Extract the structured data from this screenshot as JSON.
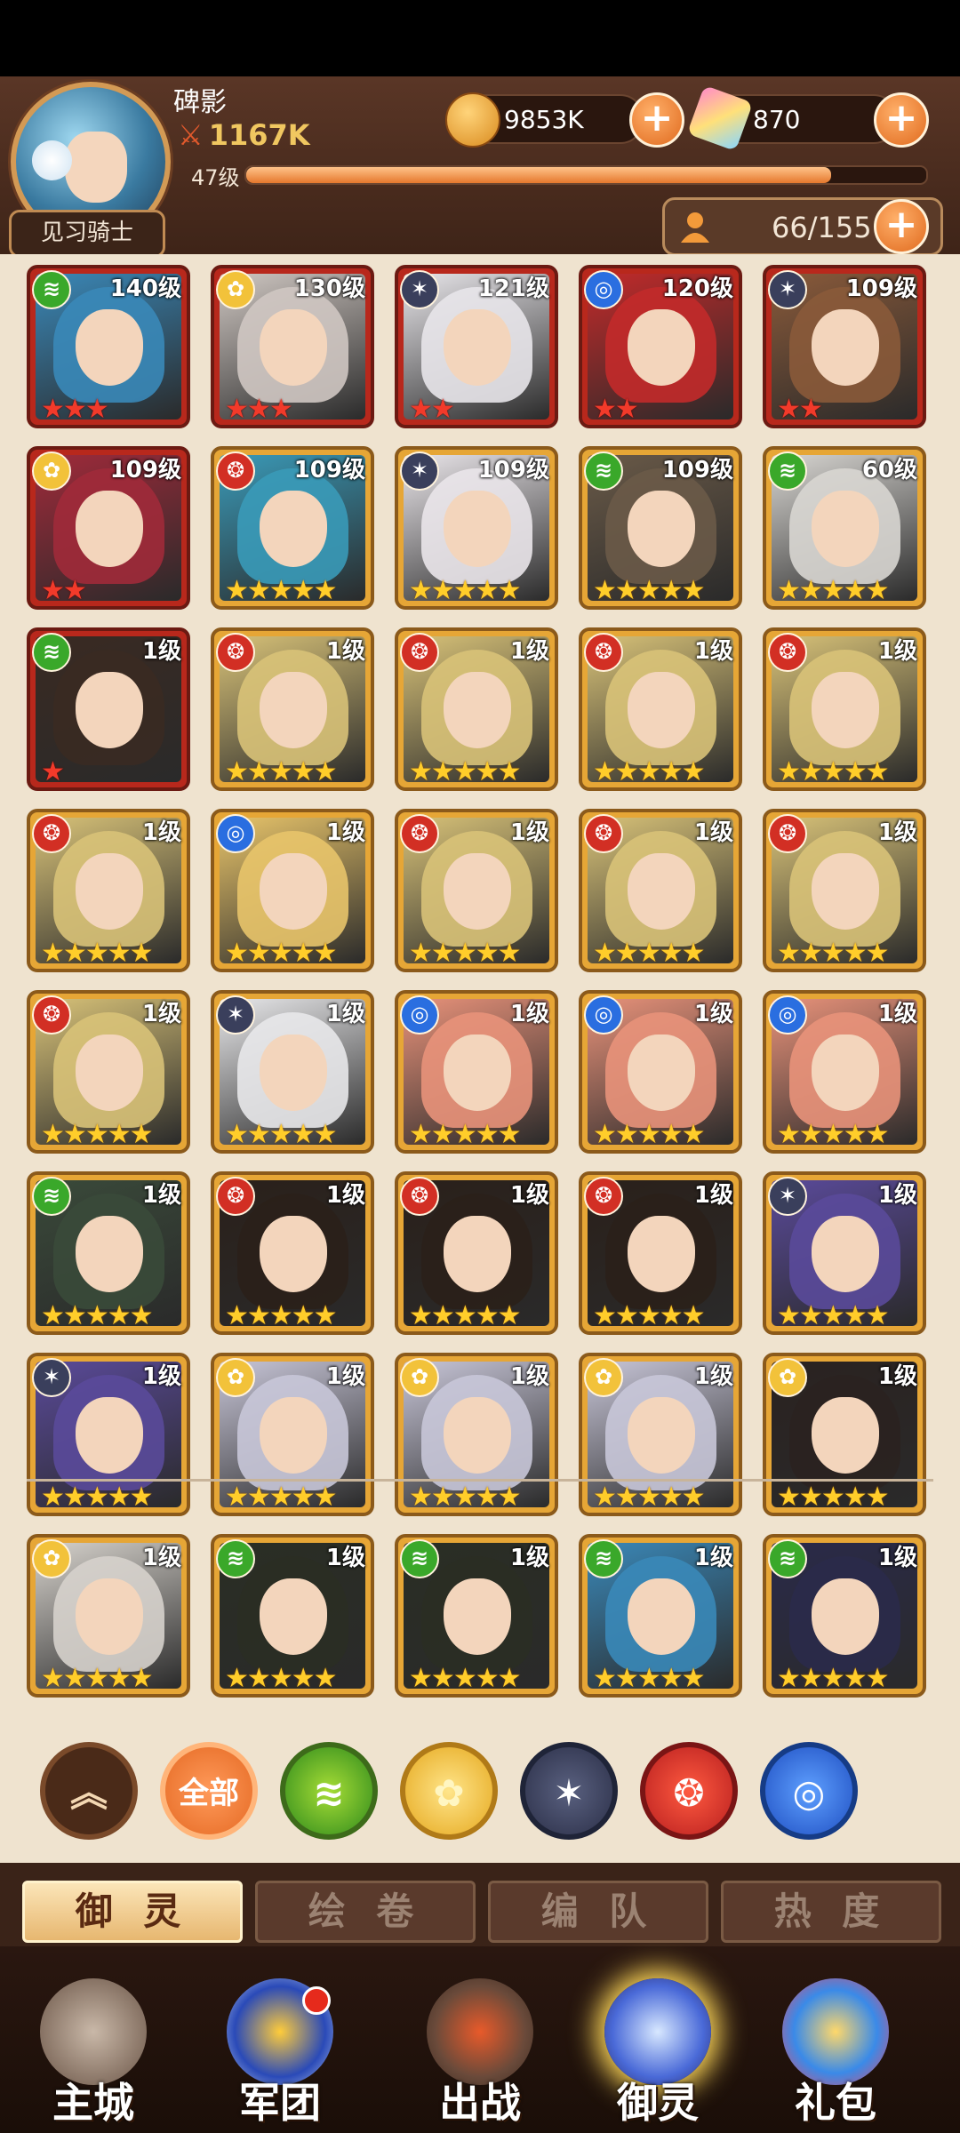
{
  "player": {
    "name": "碑影",
    "power": "1167K",
    "level": "47级",
    "xp_fraction": 0.86,
    "title": "见习骑士"
  },
  "currency": {
    "gold": "9853K",
    "gems": "870"
  },
  "capacity": "66/155",
  "colors": {
    "wind": "#3aa82a",
    "light": "#f2c23a",
    "dark": "#3a3f5c",
    "fire": "#d22f24",
    "water": "#2a6ee0"
  },
  "heroes": [
    {
      "element": "wind",
      "level": "140级",
      "stars": 3,
      "star_color": "red",
      "frame": "red",
      "tone": "#3a88b8"
    },
    {
      "element": "light",
      "level": "130级",
      "stars": 3,
      "star_color": "red",
      "frame": "red",
      "tone": "#cfc7c2"
    },
    {
      "element": "dark",
      "level": "121级",
      "stars": 2,
      "star_color": "red",
      "frame": "red",
      "tone": "#e8e6ea"
    },
    {
      "element": "water",
      "level": "120级",
      "stars": 2,
      "star_color": "red",
      "frame": "red",
      "tone": "#c22a2a"
    },
    {
      "element": "dark",
      "level": "109级",
      "stars": 2,
      "star_color": "red",
      "frame": "red",
      "tone": "#8a5a3a"
    },
    {
      "element": "light",
      "level": "109级",
      "stars": 2,
      "star_color": "red",
      "frame": "red",
      "tone": "#a02a3a"
    },
    {
      "element": "fire",
      "level": "109级",
      "stars": 5,
      "star_color": "gold",
      "frame": "gold",
      "tone": "#3a9ab8"
    },
    {
      "element": "dark",
      "level": "109级",
      "stars": 5,
      "star_color": "gold",
      "frame": "gold",
      "tone": "#eae6ea"
    },
    {
      "element": "wind",
      "level": "109级",
      "stars": 5,
      "star_color": "gold",
      "frame": "gold",
      "tone": "#6a5a48"
    },
    {
      "element": "wind",
      "level": "60级",
      "stars": 5,
      "star_color": "gold",
      "frame": "gold",
      "tone": "#d8d6d2"
    },
    {
      "element": "wind",
      "level": "1级",
      "stars": 1,
      "star_color": "red",
      "frame": "red",
      "tone": "#3a2a22"
    },
    {
      "element": "fire",
      "level": "1级",
      "stars": 5,
      "star_color": "gold",
      "frame": "gold",
      "tone": "#d8c278"
    },
    {
      "element": "fire",
      "level": "1级",
      "stars": 5,
      "star_color": "gold",
      "frame": "gold",
      "tone": "#d8c278"
    },
    {
      "element": "fire",
      "level": "1级",
      "stars": 5,
      "star_color": "gold",
      "frame": "gold",
      "tone": "#d8c278"
    },
    {
      "element": "fire",
      "level": "1级",
      "stars": 5,
      "star_color": "gold",
      "frame": "gold",
      "tone": "#d8c278"
    },
    {
      "element": "fire",
      "level": "1级",
      "stars": 5,
      "star_color": "gold",
      "frame": "gold",
      "tone": "#d8c278"
    },
    {
      "element": "water",
      "level": "1级",
      "stars": 5,
      "star_color": "gold",
      "frame": "gold",
      "tone": "#e8c46a"
    },
    {
      "element": "fire",
      "level": "1级",
      "stars": 5,
      "star_color": "gold",
      "frame": "gold",
      "tone": "#d8c278"
    },
    {
      "element": "fire",
      "level": "1级",
      "stars": 5,
      "star_color": "gold",
      "frame": "gold",
      "tone": "#d8c278"
    },
    {
      "element": "fire",
      "level": "1级",
      "stars": 5,
      "star_color": "gold",
      "frame": "gold",
      "tone": "#d8c278"
    },
    {
      "element": "fire",
      "level": "1级",
      "stars": 5,
      "star_color": "gold",
      "frame": "gold",
      "tone": "#d8c278"
    },
    {
      "element": "dark",
      "level": "1级",
      "stars": 5,
      "star_color": "gold",
      "frame": "gold",
      "tone": "#e8e8ea"
    },
    {
      "element": "water",
      "level": "1级",
      "stars": 5,
      "star_color": "gold",
      "frame": "gold",
      "tone": "#e8927a"
    },
    {
      "element": "water",
      "level": "1级",
      "stars": 5,
      "star_color": "gold",
      "frame": "gold",
      "tone": "#e8927a"
    },
    {
      "element": "water",
      "level": "1级",
      "stars": 5,
      "star_color": "gold",
      "frame": "gold",
      "tone": "#e8927a"
    },
    {
      "element": "wind",
      "level": "1级",
      "stars": 5,
      "star_color": "gold",
      "frame": "gold",
      "tone": "#3a4a3a"
    },
    {
      "element": "fire",
      "level": "1级",
      "stars": 5,
      "star_color": "gold",
      "frame": "gold",
      "tone": "#2a201a"
    },
    {
      "element": "fire",
      "level": "1级",
      "stars": 5,
      "star_color": "gold",
      "frame": "gold",
      "tone": "#2a201a"
    },
    {
      "element": "fire",
      "level": "1级",
      "stars": 5,
      "star_color": "gold",
      "frame": "gold",
      "tone": "#2a201a"
    },
    {
      "element": "dark",
      "level": "1级",
      "stars": 5,
      "star_color": "gold",
      "frame": "gold",
      "tone": "#5a4a9a"
    },
    {
      "element": "dark",
      "level": "1级",
      "stars": 5,
      "star_color": "gold",
      "frame": "gold",
      "tone": "#5a4a9a"
    },
    {
      "element": "light",
      "level": "1级",
      "stars": 5,
      "star_color": "gold",
      "frame": "gold",
      "tone": "#c8c6d8"
    },
    {
      "element": "light",
      "level": "1级",
      "stars": 5,
      "star_color": "gold",
      "frame": "gold",
      "tone": "#c8c6d8"
    },
    {
      "element": "light",
      "level": "1级",
      "stars": 5,
      "star_color": "gold",
      "frame": "gold",
      "tone": "#c8c6d8"
    },
    {
      "element": "light",
      "level": "1级",
      "stars": 5,
      "star_color": "gold",
      "frame": "gold",
      "tone": "#2a2220"
    },
    {
      "element": "light",
      "level": "1级",
      "stars": 5,
      "star_color": "gold",
      "frame": "gold",
      "tone": "#d6d2cc"
    },
    {
      "element": "wind",
      "level": "1级",
      "stars": 5,
      "star_color": "gold",
      "frame": "gold",
      "tone": "#2a2e24"
    },
    {
      "element": "wind",
      "level": "1级",
      "stars": 5,
      "star_color": "gold",
      "frame": "gold",
      "tone": "#2a2e24"
    },
    {
      "element": "wind",
      "level": "1级",
      "stars": 5,
      "star_color": "gold",
      "frame": "gold",
      "tone": "#3a88b8"
    },
    {
      "element": "wind",
      "level": "1级",
      "stars": 5,
      "star_color": "gold",
      "frame": "gold",
      "tone": "#2a2a4a"
    }
  ],
  "filters": {
    "all_label": "全部"
  },
  "tabs": [
    "御 灵",
    "绘 卷",
    "编 队",
    "热 度"
  ],
  "nav": [
    "主城",
    "军团",
    "出战",
    "御灵",
    "礼包"
  ]
}
